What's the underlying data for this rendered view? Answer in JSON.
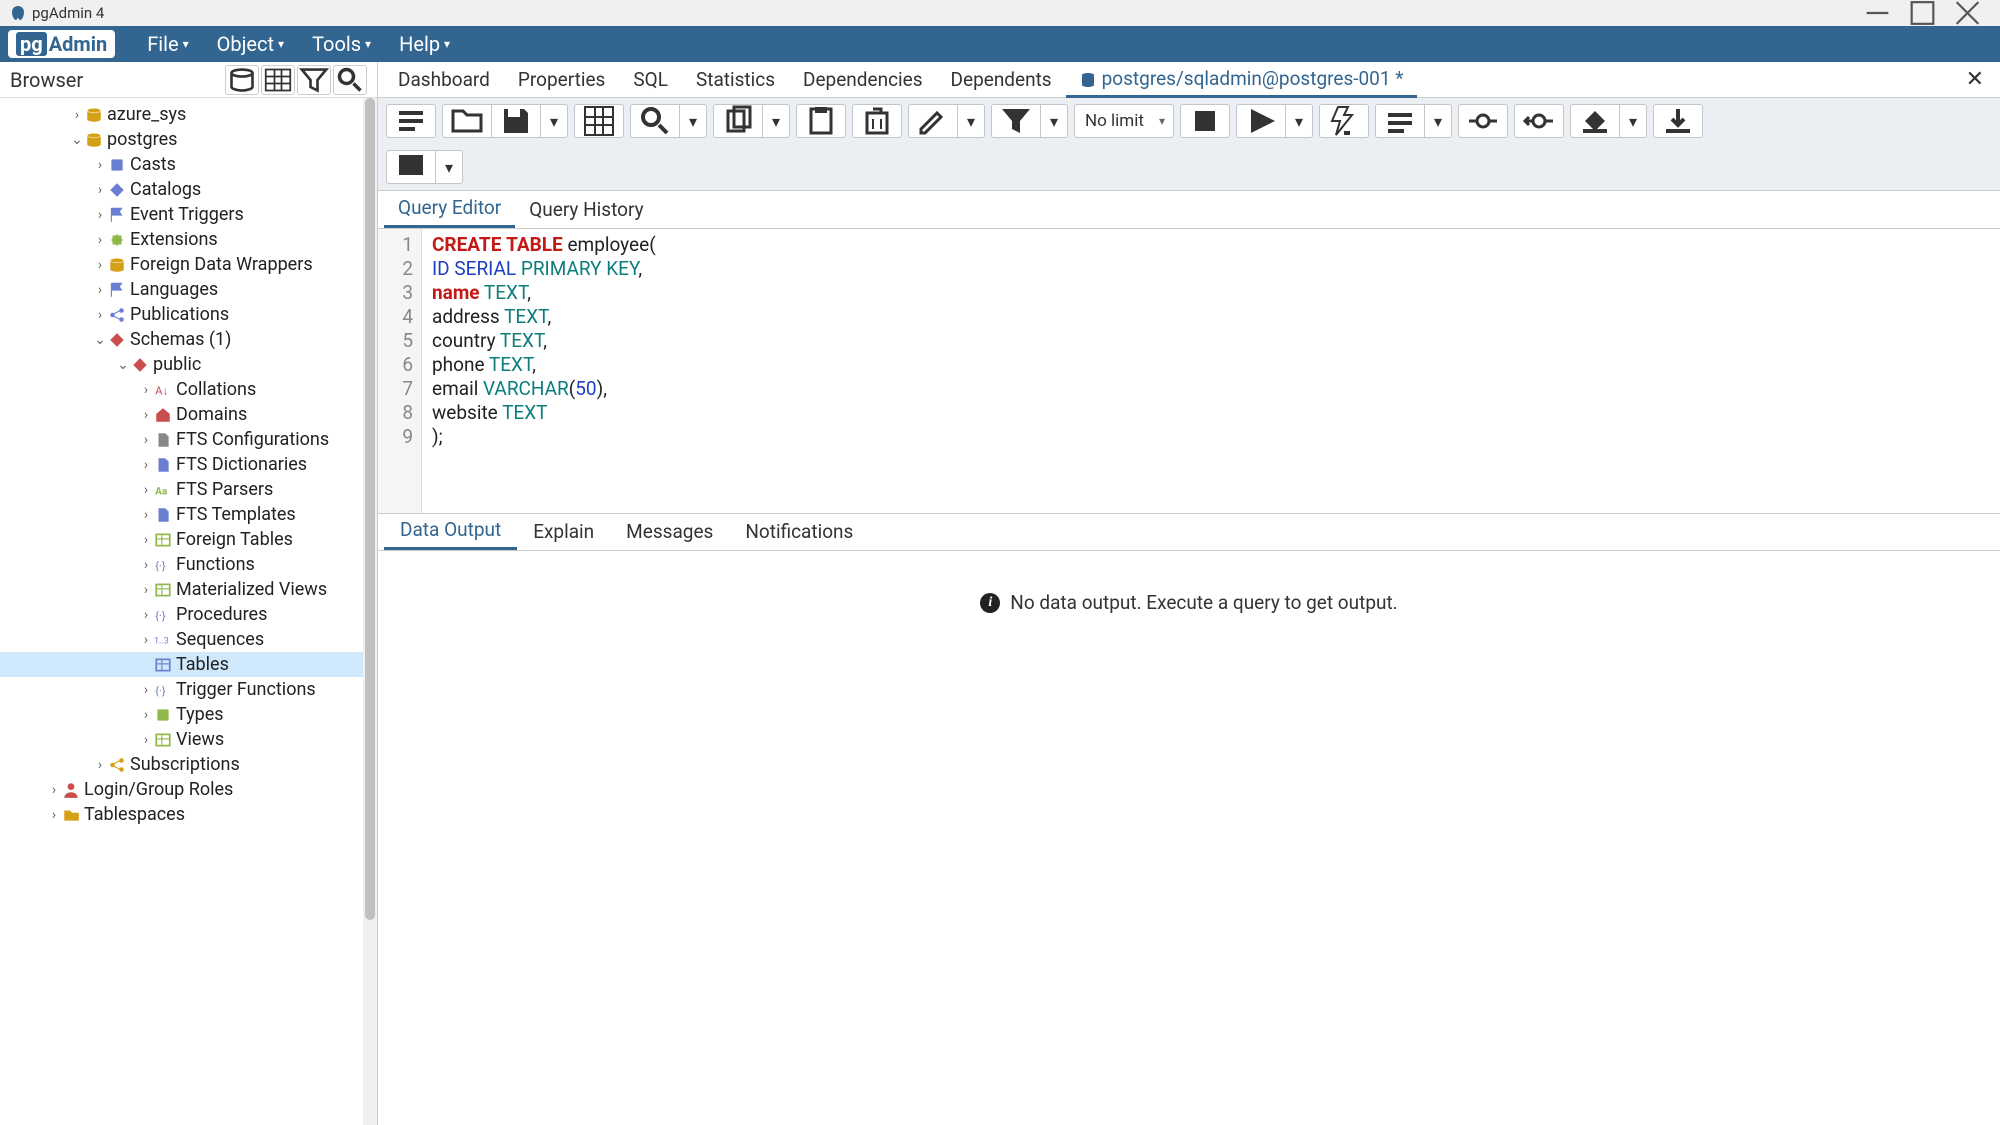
{
  "window": {
    "title": "pgAdmin 4"
  },
  "menubar": {
    "items": [
      "File",
      "Object",
      "Tools",
      "Help"
    ]
  },
  "sidebar": {
    "title": "Browser",
    "tree": [
      {
        "label": "azure_sys",
        "depth": 3,
        "toggle": "›",
        "iconColor": "#d4a017",
        "iconShape": "db"
      },
      {
        "label": "postgres",
        "depth": 3,
        "toggle": "⌄",
        "iconColor": "#d4a017",
        "iconShape": "db"
      },
      {
        "label": "Casts",
        "depth": 4,
        "toggle": "›",
        "iconColor": "#6b7fd1",
        "iconShape": "box"
      },
      {
        "label": "Catalogs",
        "depth": 4,
        "toggle": "›",
        "iconColor": "#6b7fd1",
        "iconShape": "diamond"
      },
      {
        "label": "Event Triggers",
        "depth": 4,
        "toggle": "›",
        "iconColor": "#6b7fd1",
        "iconShape": "flag"
      },
      {
        "label": "Extensions",
        "depth": 4,
        "toggle": "›",
        "iconColor": "#8fb84a",
        "iconShape": "puzzle"
      },
      {
        "label": "Foreign Data Wrappers",
        "depth": 4,
        "toggle": "›",
        "iconColor": "#d4a017",
        "iconShape": "db"
      },
      {
        "label": "Languages",
        "depth": 4,
        "toggle": "›",
        "iconColor": "#6b7fd1",
        "iconShape": "flag"
      },
      {
        "label": "Publications",
        "depth": 4,
        "toggle": "›",
        "iconColor": "#6b7fd1",
        "iconShape": "share"
      },
      {
        "label": "Schemas (1)",
        "depth": 4,
        "toggle": "⌄",
        "iconColor": "#c94d4d",
        "iconShape": "diamond"
      },
      {
        "label": "public",
        "depth": 5,
        "toggle": "⌄",
        "iconColor": "#c94d4d",
        "iconShape": "diamond"
      },
      {
        "label": "Collations",
        "depth": 6,
        "toggle": "›",
        "iconColor": "#c94d4d",
        "iconShape": "sort"
      },
      {
        "label": "Domains",
        "depth": 6,
        "toggle": "›",
        "iconColor": "#c94d4d",
        "iconShape": "house"
      },
      {
        "label": "FTS Configurations",
        "depth": 6,
        "toggle": "›",
        "iconColor": "#888",
        "iconShape": "doc"
      },
      {
        "label": "FTS Dictionaries",
        "depth": 6,
        "toggle": "›",
        "iconColor": "#6b7fd1",
        "iconShape": "doc"
      },
      {
        "label": "FTS Parsers",
        "depth": 6,
        "toggle": "›",
        "iconColor": "#8fb84a",
        "iconShape": "text"
      },
      {
        "label": "FTS Templates",
        "depth": 6,
        "toggle": "›",
        "iconColor": "#6b7fd1",
        "iconShape": "doc"
      },
      {
        "label": "Foreign Tables",
        "depth": 6,
        "toggle": "›",
        "iconColor": "#8fb84a",
        "iconShape": "table"
      },
      {
        "label": "Functions",
        "depth": 6,
        "toggle": "›",
        "iconColor": "#6b7fd1",
        "iconShape": "fn"
      },
      {
        "label": "Materialized Views",
        "depth": 6,
        "toggle": "›",
        "iconColor": "#8fb84a",
        "iconShape": "table"
      },
      {
        "label": "Procedures",
        "depth": 6,
        "toggle": "›",
        "iconColor": "#6b7fd1",
        "iconShape": "fn"
      },
      {
        "label": "Sequences",
        "depth": 6,
        "toggle": "›",
        "iconColor": "#6b7fd1",
        "iconShape": "num"
      },
      {
        "label": "Tables",
        "depth": 6,
        "toggle": "",
        "iconColor": "#6b7fd1",
        "iconShape": "table",
        "selected": true
      },
      {
        "label": "Trigger Functions",
        "depth": 6,
        "toggle": "›",
        "iconColor": "#6b7fd1",
        "iconShape": "fn"
      },
      {
        "label": "Types",
        "depth": 6,
        "toggle": "›",
        "iconColor": "#8fb84a",
        "iconShape": "box"
      },
      {
        "label": "Views",
        "depth": 6,
        "toggle": "›",
        "iconColor": "#8fb84a",
        "iconShape": "table"
      },
      {
        "label": "Subscriptions",
        "depth": 4,
        "toggle": "›",
        "iconColor": "#d4a017",
        "iconShape": "share"
      },
      {
        "label": "Login/Group Roles",
        "depth": 2,
        "toggle": "›",
        "iconColor": "#c94d4d",
        "iconShape": "user"
      },
      {
        "label": "Tablespaces",
        "depth": 2,
        "toggle": "›",
        "iconColor": "#d4a017",
        "iconShape": "folder"
      }
    ]
  },
  "tabs": {
    "items": [
      "Dashboard",
      "Properties",
      "SQL",
      "Statistics",
      "Dependencies",
      "Dependents"
    ],
    "query_tab": "postgres/sqladmin@postgres-001 *"
  },
  "toolbar": {
    "limit": "No limit"
  },
  "editor": {
    "tabs": [
      "Query Editor",
      "Query History"
    ],
    "active_tab": 0,
    "lines": [
      [
        {
          "t": "CREATE",
          "c": "kw-red"
        },
        {
          "t": " "
        },
        {
          "t": "TABLE",
          "c": "kw-red"
        },
        {
          "t": " employee("
        }
      ],
      [
        {
          "t": "ID",
          "c": "kw-blue"
        },
        {
          "t": " "
        },
        {
          "t": "SERIAL",
          "c": "kw-blue"
        },
        {
          "t": " "
        },
        {
          "t": "PRIMARY",
          "c": "kw-teal"
        },
        {
          "t": " "
        },
        {
          "t": "KEY",
          "c": "kw-teal"
        },
        {
          "t": ","
        }
      ],
      [
        {
          "t": "name",
          "c": "kw-red"
        },
        {
          "t": " "
        },
        {
          "t": "TEXT",
          "c": "kw-teal"
        },
        {
          "t": ","
        }
      ],
      [
        {
          "t": "address "
        },
        {
          "t": "TEXT",
          "c": "kw-teal"
        },
        {
          "t": ","
        }
      ],
      [
        {
          "t": "country "
        },
        {
          "t": "TEXT",
          "c": "kw-teal"
        },
        {
          "t": ","
        }
      ],
      [
        {
          "t": "phone "
        },
        {
          "t": "TEXT",
          "c": "kw-teal"
        },
        {
          "t": ","
        }
      ],
      [
        {
          "t": "email "
        },
        {
          "t": "VARCHAR",
          "c": "kw-teal"
        },
        {
          "t": "("
        },
        {
          "t": "50",
          "c": "num"
        },
        {
          "t": "),"
        }
      ],
      [
        {
          "t": "website "
        },
        {
          "t": "TEXT",
          "c": "kw-teal"
        }
      ],
      [
        {
          "t": ");"
        }
      ]
    ]
  },
  "output": {
    "tabs": [
      "Data Output",
      "Explain",
      "Messages",
      "Notifications"
    ],
    "active_tab": 0,
    "message": "No data output. Execute a query to get output."
  }
}
